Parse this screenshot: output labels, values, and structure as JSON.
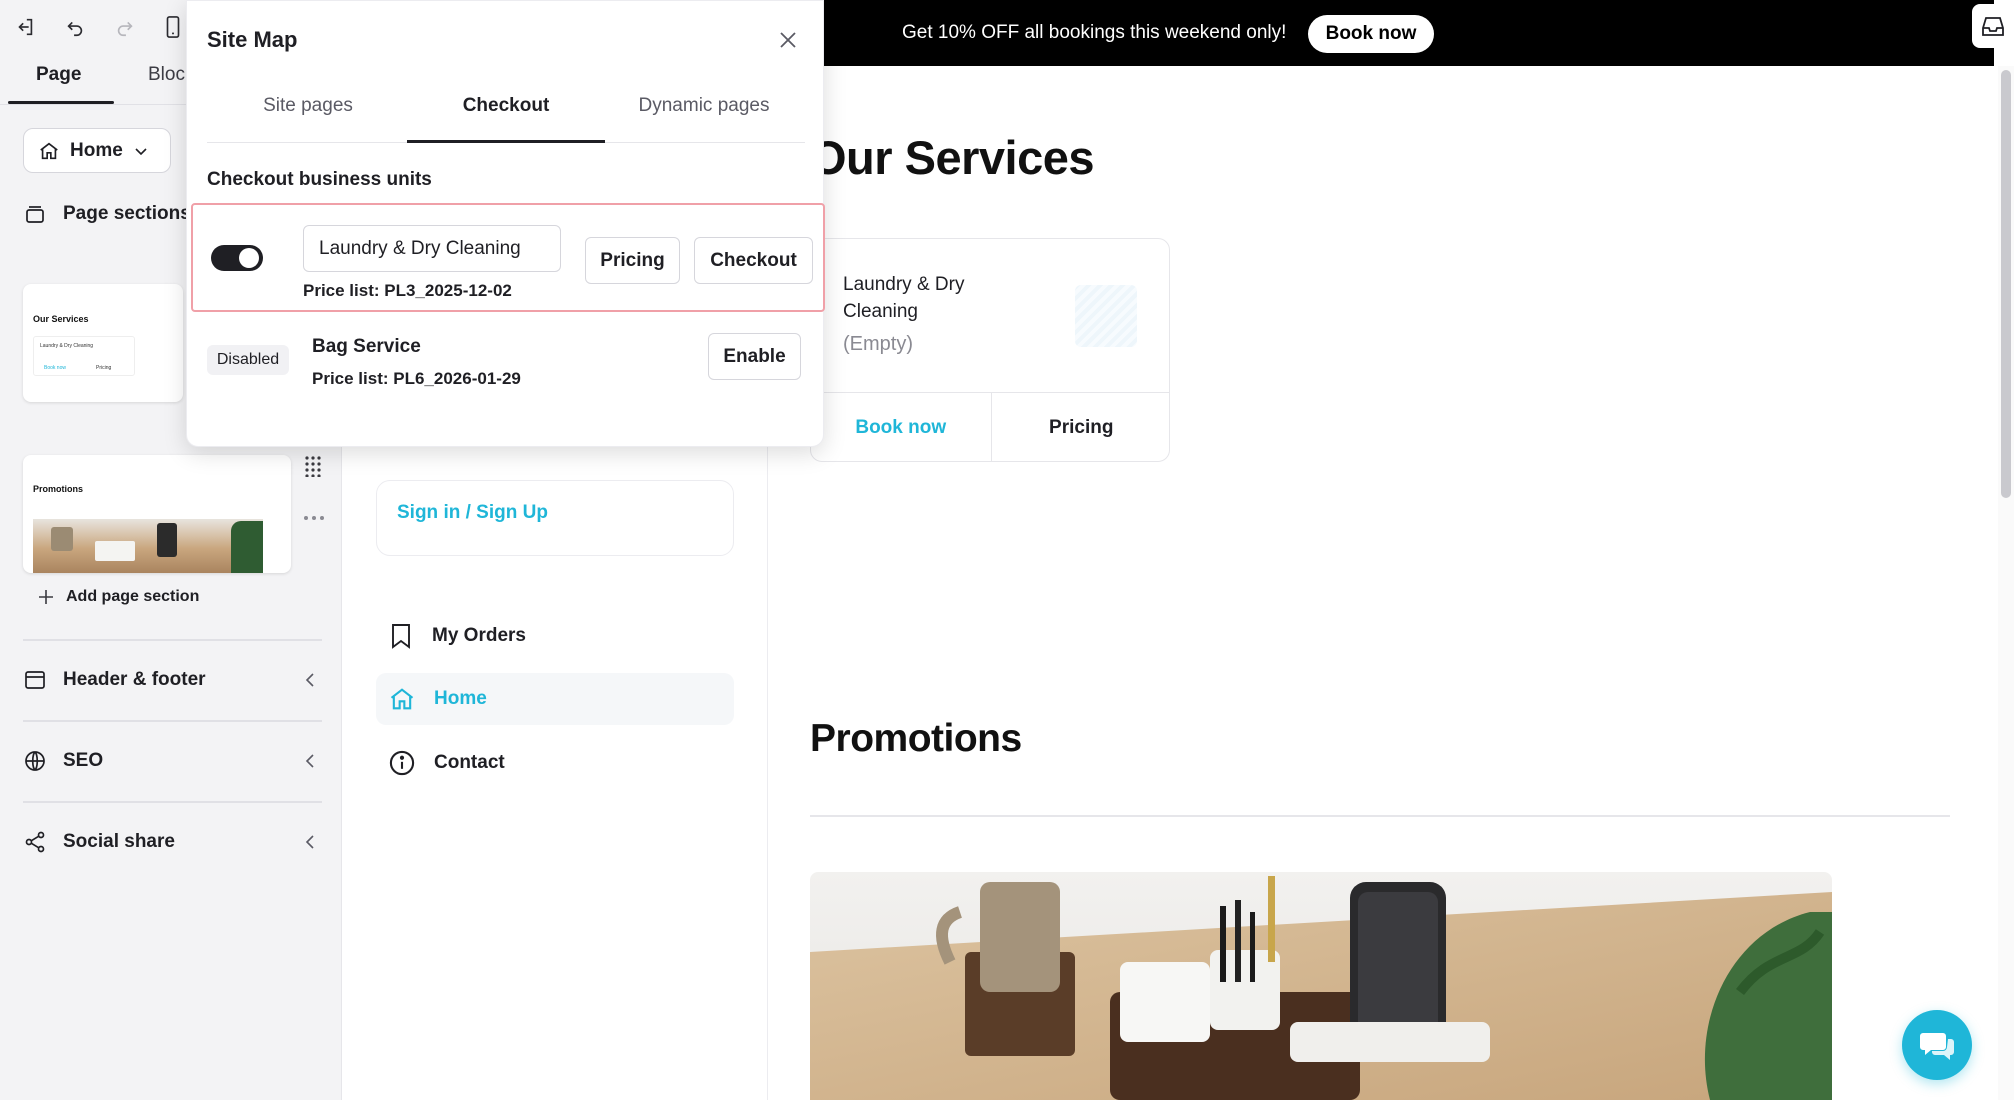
{
  "sidebar": {
    "tabs": [
      {
        "label": "Page"
      },
      {
        "label": "Bloc"
      }
    ],
    "home_select": {
      "label": "Home"
    },
    "page_sections_label": "Page sections",
    "thumbnails": [
      {
        "title": "Our Services",
        "card_text": "Laundry & Dry Cleaning",
        "book": "Book now",
        "pricing": "Pricing"
      },
      {
        "title": "Promotions"
      }
    ],
    "add_section_label": "Add page section",
    "nav": [
      {
        "label": "Header & footer",
        "icon": "layout-icon"
      },
      {
        "label": "SEO",
        "icon": "globe-icon"
      },
      {
        "label": "Social share",
        "icon": "share-icon"
      }
    ]
  },
  "preview_menu": {
    "signin": "Sign in / Sign Up",
    "items": [
      {
        "label": "My Orders",
        "icon": "bookmark-icon"
      },
      {
        "label": "Home",
        "icon": "home-icon",
        "active": true
      },
      {
        "label": "Contact",
        "icon": "info-icon"
      }
    ]
  },
  "site": {
    "banner": {
      "text": "Get 10% OFF all bookings this weekend only!",
      "button": "Book now"
    },
    "services_title": "Our Services",
    "service_card": {
      "name": "Laundry & Dry Cleaning",
      "status": "(Empty)",
      "book": "Book now",
      "pricing": "Pricing"
    },
    "promotions_title": "Promotions"
  },
  "sitemap": {
    "title": "Site Map",
    "tabs": [
      {
        "label": "Site pages"
      },
      {
        "label": "Checkout",
        "active": true
      },
      {
        "label": "Dynamic pages"
      }
    ],
    "section_title": "Checkout business units",
    "units": [
      {
        "name": "Laundry & Dry Cleaning",
        "price_list": "Price list: PL3_2025-12-02",
        "enabled": true,
        "buttons": [
          "Pricing",
          "Checkout"
        ]
      },
      {
        "name": "Bag Service",
        "price_list": "Price list: PL6_2026-01-29",
        "enabled": false,
        "status": "Disabled",
        "button": "Enable"
      }
    ]
  },
  "colors": {
    "accent": "#1fb6d8",
    "highlight_border": "#f0a0a8",
    "banner_bg": "#000000"
  }
}
